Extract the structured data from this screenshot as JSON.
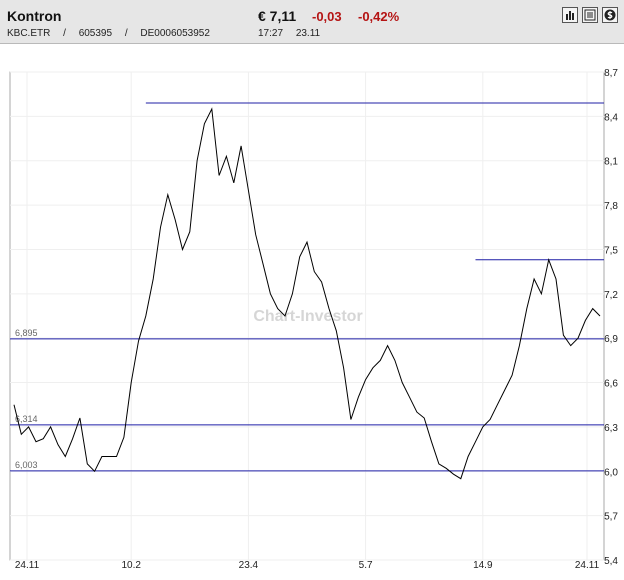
{
  "header": {
    "name": "Kontron",
    "exchange": "KBC.ETR",
    "wkn": "605395",
    "isin": "DE0006053952",
    "sep": "/",
    "price": "€ 7,11",
    "change": "-0,03",
    "change_pct": "-0,42%",
    "time": "17:27",
    "date": "23.11",
    "icons": [
      "bar-chart-icon",
      "news-icon",
      "dollar-sign-icon"
    ]
  },
  "watermark": "Chart-Investor",
  "colors": {
    "line": "#000000",
    "reference_line": "#1f1fa6",
    "negative": "#b51414",
    "header_bg": "#e6e6e6"
  },
  "chart_data": {
    "type": "line",
    "x_ticks": [
      "24.11",
      "10.2",
      "23.4",
      "5.7",
      "14.9",
      "24.11"
    ],
    "y_ticks": [
      "5,4",
      "5,7",
      "6,0",
      "6,3",
      "6,6",
      "6,9",
      "7,2",
      "7,5",
      "7,8",
      "8,1",
      "8,4",
      "8,7"
    ],
    "ylim": [
      5.4,
      8.7
    ],
    "grid": true,
    "reference_lines": [
      {
        "label": "6,895",
        "value": 6.895
      },
      {
        "label": "6,314",
        "value": 6.314
      },
      {
        "label": "6,003",
        "value": 6.003
      },
      {
        "label": "",
        "value": 8.49,
        "from_index": 18
      },
      {
        "label": "",
        "value": 7.43,
        "from_index": 63
      }
    ],
    "series": [
      {
        "values": [
          6.45,
          6.25,
          6.3,
          6.2,
          6.22,
          6.3,
          6.18,
          6.1,
          6.22,
          6.36,
          6.05,
          6.0,
          6.1,
          6.1,
          6.1,
          6.23,
          6.6,
          6.88,
          7.05,
          7.3,
          7.65,
          7.87,
          7.7,
          7.5,
          7.62,
          8.1,
          8.35,
          8.45,
          8.0,
          8.13,
          7.95,
          8.2,
          7.9,
          7.6,
          7.4,
          7.2,
          7.1,
          7.05,
          7.2,
          7.45,
          7.55,
          7.35,
          7.28,
          7.1,
          6.95,
          6.7,
          6.35,
          6.5,
          6.62,
          6.7,
          6.75,
          6.85,
          6.75,
          6.6,
          6.5,
          6.4,
          6.36,
          6.2,
          6.05,
          6.02,
          5.98,
          5.95,
          6.1,
          6.2,
          6.3,
          6.35,
          6.45,
          6.55,
          6.65,
          6.85,
          7.1,
          7.3,
          7.2,
          7.43,
          7.3,
          6.92,
          6.85,
          6.9,
          7.02,
          7.1,
          7.05
        ]
      }
    ]
  }
}
